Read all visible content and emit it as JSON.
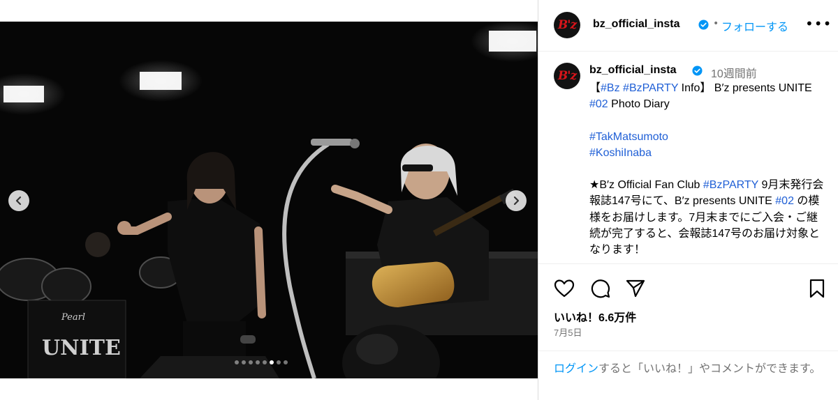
{
  "post": {
    "username": "bz_official_insta",
    "avatar_logo": "B'z",
    "follow_label": "フォローする",
    "separator": "•",
    "more_label": "•••",
    "time_ago": "10週間前",
    "caption_parts": [
      {
        "text": "【",
        "tag": false
      },
      {
        "text": "#Bz",
        "tag": true
      },
      {
        "text": " ",
        "tag": false
      },
      {
        "text": "#BzPARTY",
        "tag": true
      },
      {
        "text": " Info】 B′z presents UNITE ",
        "tag": false
      },
      {
        "text": "#02",
        "tag": true
      },
      {
        "text": " Photo Diary\n\n",
        "tag": false
      },
      {
        "text": "#TakMatsumoto",
        "tag": true
      },
      {
        "text": "\n",
        "tag": false
      },
      {
        "text": "#KoshiInaba",
        "tag": true
      },
      {
        "text": "\n\n★B′z Official Fan Club ",
        "tag": false
      },
      {
        "text": "#BzPARTY",
        "tag": true
      },
      {
        "text": " 9月末発行会報誌147号にて、B′z presents UNITE ",
        "tag": false
      },
      {
        "text": "#02",
        "tag": true
      },
      {
        "text": " の模様をお届けします。7月末までにご入会・ご継続が完了すると、会報誌147号のお届け対象となります！",
        "tag": false
      }
    ],
    "likes": "いいね！6.6万件",
    "date": "7月5日",
    "login_link": "ログイン",
    "login_rest": "すると「いいね！」やコメントができます。"
  },
  "media": {
    "slide_count": 8,
    "active_slide": 5,
    "stage_text": "UNITE",
    "drum_brand": "Pearl"
  },
  "icons": {
    "prev": "chevron-left-icon",
    "next": "chevron-right-icon",
    "like": "heart-icon",
    "comment": "comment-icon",
    "share": "paper-plane-icon",
    "save": "bookmark-icon",
    "verified": "verified-badge-icon"
  },
  "colors": {
    "accent": "#0095f6",
    "tag": "#1f5fd6",
    "muted": "#737373",
    "verified": "#0095f6",
    "logo_red": "#d8141a"
  }
}
